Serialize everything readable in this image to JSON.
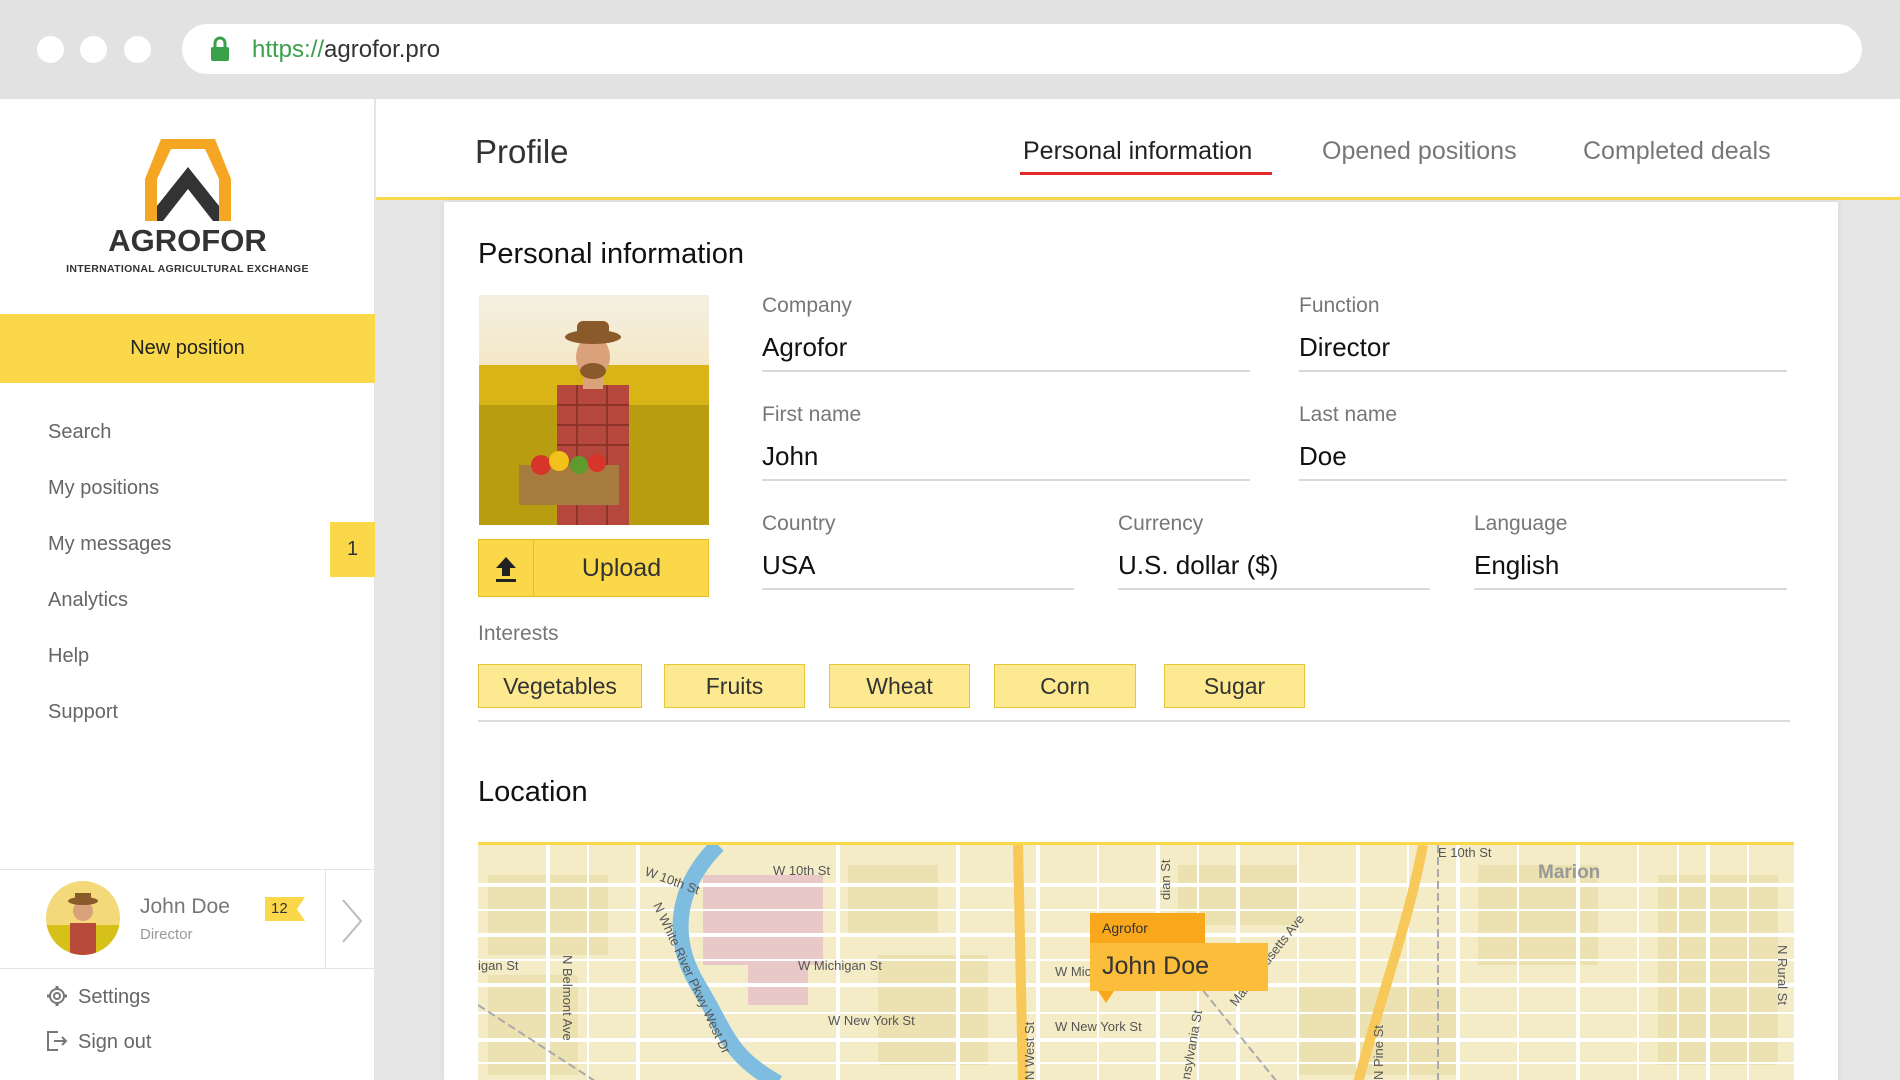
{
  "browser": {
    "url_scheme": "https://",
    "url_host": "agrofor.pro"
  },
  "brand": {
    "name": "AGROFOR",
    "tagline": "INTERNATIONAL AGRICULTURAL EXCHANGE",
    "accent": "#fbd849"
  },
  "sidebar": {
    "new_position": "New position",
    "items": [
      {
        "label": "Search"
      },
      {
        "label": "My positions"
      },
      {
        "label": "My messages",
        "badge": "1"
      },
      {
        "label": "Analytics"
      },
      {
        "label": "Help"
      },
      {
        "label": "Support"
      }
    ],
    "user": {
      "name": "John Doe",
      "role": "Director",
      "count": "12"
    },
    "settings": "Settings",
    "signout": "Sign out"
  },
  "header": {
    "title": "Profile",
    "tabs": [
      {
        "label": "Personal information",
        "active": true
      },
      {
        "label": "Opened positions"
      },
      {
        "label": "Completed deals"
      }
    ]
  },
  "personal": {
    "title": "Personal information",
    "upload": "Upload",
    "fields": {
      "company": {
        "label": "Company",
        "value": "Agrofor"
      },
      "function": {
        "label": "Function",
        "value": "Director"
      },
      "first_name": {
        "label": "First name",
        "value": "John"
      },
      "last_name": {
        "label": "Last name",
        "value": "Doe"
      },
      "country": {
        "label": "Country",
        "value": "USA"
      },
      "currency": {
        "label": "Currency",
        "value": "U.S. dollar ($)"
      },
      "language": {
        "label": "Language",
        "value": "English"
      }
    },
    "interests_label": "Interests",
    "interests": [
      "Vegetables",
      "Fruits",
      "Wheat",
      "Corn",
      "Sugar"
    ]
  },
  "location": {
    "title": "Location",
    "pin_company": "Agrofor",
    "pin_name": "John Doe",
    "labels": {
      "w10th": "W 10th St",
      "w10th2": "W 10th St",
      "e10th": "E 10th St",
      "marion": "Marion",
      "michigan_w": "igan St",
      "belmont": "N Belmont Ave",
      "whiteriver": "N White River Pkwy West Dr",
      "wmichigan": "W Michigan St",
      "wnewyork": "W New York St",
      "wnewyork2": "W New York St",
      "westst": "N West St",
      "wmich2": "W Michi",
      "meridian": "dian St",
      "pennsylvania": "nsylvania St",
      "massachusetts": "Massachusetts Ave",
      "pine": "N Pine St",
      "rural": "N Rural St"
    }
  }
}
